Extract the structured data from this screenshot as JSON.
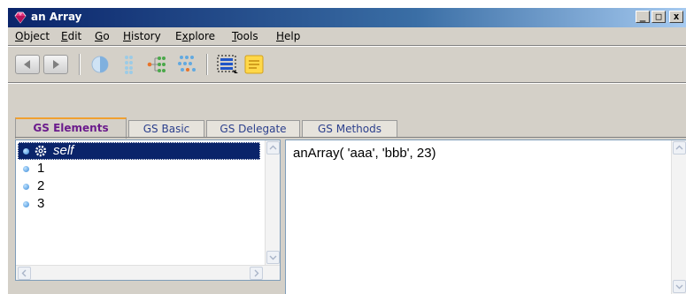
{
  "window": {
    "title": "an Array",
    "controls": {
      "minimize": "_",
      "maximize": "□",
      "close": "x"
    }
  },
  "menubar": {
    "items": [
      {
        "label": "Object",
        "mnemonic": "O",
        "rest": "bject"
      },
      {
        "label": "Edit",
        "mnemonic": "E",
        "rest": "dit"
      },
      {
        "label": "Go",
        "mnemonic": "G",
        "rest": "o"
      },
      {
        "label": "History",
        "mnemonic": "H",
        "rest": "istory"
      },
      {
        "label": "Explore",
        "mnemonic": "x",
        "pre": "E",
        "rest": "plore"
      },
      {
        "label": "Tools",
        "mnemonic": "T",
        "rest": "ools"
      },
      {
        "label": "Help",
        "mnemonic": "H",
        "rest": "elp"
      }
    ]
  },
  "toolbar": {
    "buttons": [
      {
        "name": "back-button",
        "icon": "arrow-left-icon"
      },
      {
        "name": "forward-button",
        "icon": "arrow-right-icon"
      },
      {
        "name": "inspect-button",
        "icon": "half-circle-icon"
      },
      {
        "name": "explore-button",
        "icon": "tree-dots-icon"
      },
      {
        "name": "explore-refs-button",
        "icon": "branch-dots-icon"
      },
      {
        "name": "graph-button",
        "icon": "graph-dots-icon"
      },
      {
        "name": "select-list-button",
        "icon": "dashed-list-icon"
      },
      {
        "name": "notes-button",
        "icon": "note-icon"
      }
    ]
  },
  "tabs": [
    {
      "label": "GS Elements",
      "active": true
    },
    {
      "label": "GS Basic",
      "active": false
    },
    {
      "label": "GS Delegate",
      "active": false
    },
    {
      "label": "GS Methods",
      "active": false
    }
  ],
  "elements_list": {
    "items": [
      {
        "label": "self",
        "selected": true
      },
      {
        "label": "1",
        "selected": false
      },
      {
        "label": "2",
        "selected": false
      },
      {
        "label": "3",
        "selected": false
      }
    ]
  },
  "print_pane": {
    "text": "anArray( 'aaa', 'bbb', 23)"
  },
  "colors": {
    "titlebar": "#0a246a",
    "selection": "#0a246a",
    "active_tab_text": "#6b1b8c",
    "tab_text": "#2b3f8c",
    "active_tab_accent": "#f0a030"
  }
}
